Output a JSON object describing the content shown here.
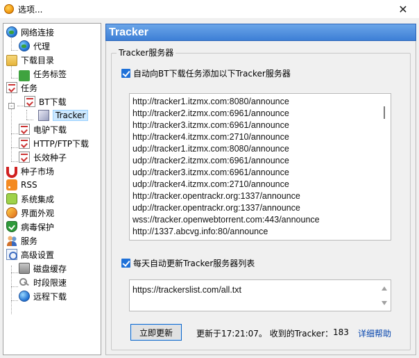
{
  "window": {
    "title": "选项...",
    "close_glyph": "✕"
  },
  "tree": {
    "items": [
      {
        "label": "网络连接",
        "icon": "globe-icon"
      },
      {
        "label": "代理",
        "icon": "globe-icon"
      },
      {
        "label": "下载目录",
        "icon": "folder-icon"
      },
      {
        "label": "任务标签",
        "icon": "tag-icon"
      },
      {
        "label": "任务",
        "icon": "task-icon"
      },
      {
        "label": "BT下载",
        "icon": "task-icon"
      },
      {
        "label": "Tracker",
        "icon": "box-icon",
        "selected": true
      },
      {
        "label": "电驴下载",
        "icon": "task-icon"
      },
      {
        "label": "HTTP/FTP下载",
        "icon": "task-icon"
      },
      {
        "label": "长效种子",
        "icon": "task-icon"
      },
      {
        "label": "种子市场",
        "icon": "magnet-icon"
      },
      {
        "label": "RSS",
        "icon": "rss-icon"
      },
      {
        "label": "系统集成",
        "icon": "puzzle-icon"
      },
      {
        "label": "界面外观",
        "icon": "paint-icon"
      },
      {
        "label": "病毒保护",
        "icon": "shield-icon"
      },
      {
        "label": "服务",
        "icon": "people-icon"
      },
      {
        "label": "高级设置",
        "icon": "settings-icon"
      },
      {
        "label": "磁盘缓存",
        "icon": "disk-icon"
      },
      {
        "label": "时段限速",
        "icon": "key-icon"
      },
      {
        "label": "远程下载",
        "icon": "remote-icon"
      }
    ]
  },
  "panel": {
    "header": "Tracker",
    "group_title": "Tracker服务器",
    "auto_add_checkbox": {
      "label": "自动向BT下载任务添加以下Tracker服务器",
      "checked": true
    },
    "trackers": [
      "http://tracker1.itzmx.com:8080/announce",
      "http://tracker2.itzmx.com:6961/announce",
      "http://tracker3.itzmx.com:6961/announce",
      "http://tracker4.itzmx.com:2710/announce",
      "udp://tracker1.itzmx.com:8080/announce",
      "udp://tracker2.itzmx.com:6961/announce",
      "udp://tracker3.itzmx.com:6961/announce",
      "udp://tracker4.itzmx.com:2710/announce",
      "http://tracker.opentrackr.org:1337/announce",
      "udp://tracker.opentrackr.org:1337/announce",
      "wss://tracker.openwebtorrent.com:443/announce",
      "http://1337.abcvg.info:80/announce"
    ],
    "auto_update_checkbox": {
      "label": "每天自动更新Tracker服务器列表",
      "checked": true
    },
    "update_url": "https://trackerslist.com/all.txt",
    "update_button": "立即更新",
    "status": "更新于17:21:07。 收到的Tracker：",
    "tracker_count": "183",
    "help_link": "详细帮助"
  }
}
